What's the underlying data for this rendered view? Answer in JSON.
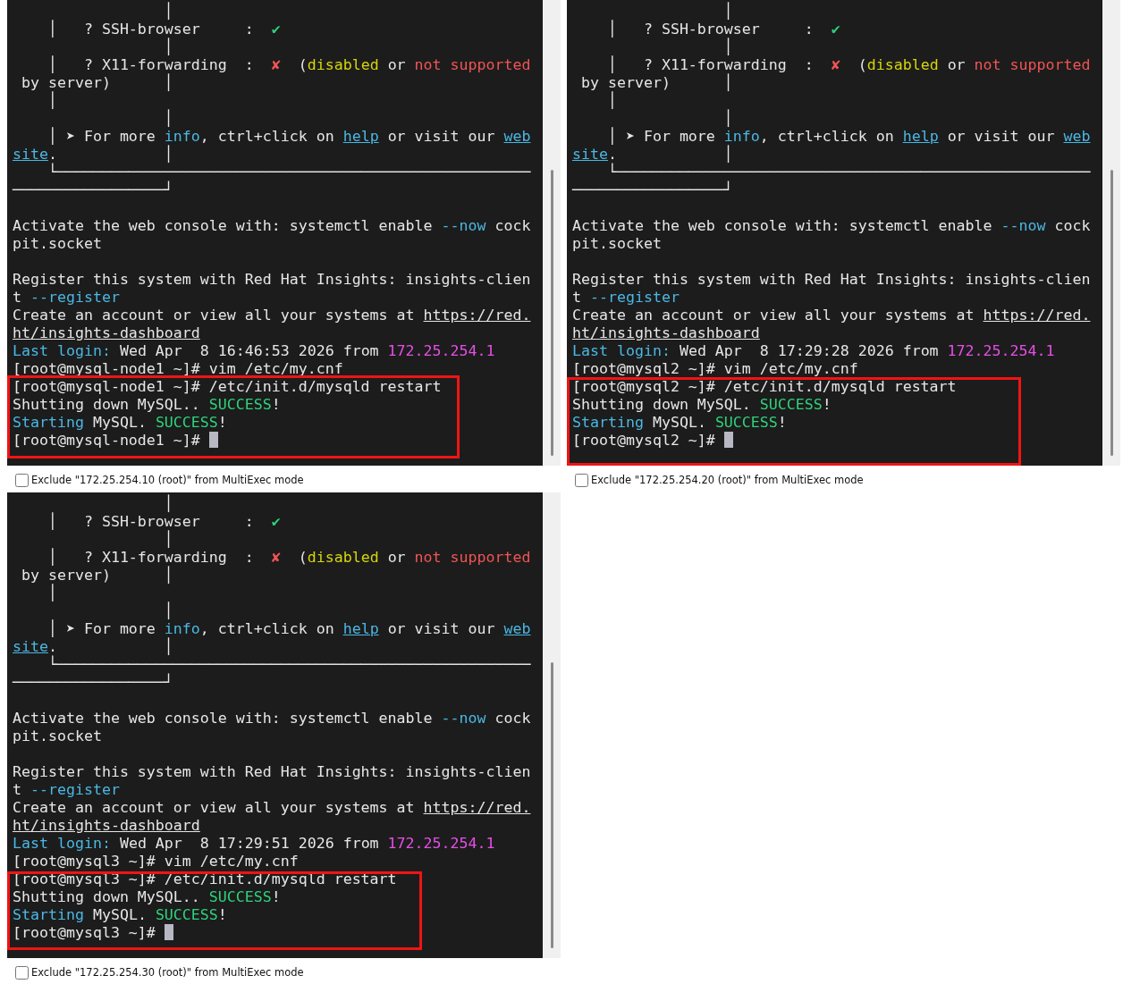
{
  "panes": [
    {
      "annotation_box": true,
      "lines": [
        {
          "spans": [
            {
              "text": "                 │"
            }
          ]
        },
        {
          "spans": [
            {
              "text": "    │   ? SSH-browser     :  "
            },
            {
              "text": "✔",
              "kind": "green"
            }
          ]
        },
        {
          "spans": [
            {
              "text": "                 │"
            }
          ]
        },
        {
          "spans": [
            {
              "text": "    │   ? X11-forwarding  :  "
            },
            {
              "text": "✘",
              "kind": "red"
            },
            {
              "text": "  ("
            },
            {
              "text": "disabled",
              "kind": "yellow"
            },
            {
              "text": " or "
            },
            {
              "text": "not supported",
              "kind": "red"
            }
          ]
        },
        {
          "spans": [
            {
              "text": " by server)      │"
            }
          ]
        },
        {
          "spans": [
            {
              "text": "    │"
            }
          ]
        },
        {
          "spans": [
            {
              "text": "                 │"
            }
          ]
        },
        {
          "spans": [
            {
              "text": "    │ ➤ For more "
            },
            {
              "text": "info",
              "kind": "cyan"
            },
            {
              "text": ", ctrl+click on "
            },
            {
              "text": "help",
              "kind": "link"
            },
            {
              "text": " or visit our "
            },
            {
              "text": "web",
              "kind": "link"
            }
          ]
        },
        {
          "spans": [
            {
              "text": "site",
              "kind": "link"
            },
            {
              "text": ".            │"
            }
          ]
        },
        {
          "spans": [
            {
              "text": "    └─────────────────────────────────────────────────────"
            }
          ]
        },
        {
          "spans": [
            {
              "text": "─────────────────┘"
            }
          ]
        },
        {
          "kind": "blank"
        },
        {
          "spans": [
            {
              "text": "Activate the web console with: systemctl enable "
            },
            {
              "text": "--now",
              "kind": "cyan"
            },
            {
              "text": " cock"
            }
          ]
        },
        {
          "spans": [
            {
              "text": "pit.socket"
            }
          ]
        },
        {
          "kind": "blank"
        },
        {
          "spans": [
            {
              "text": "Register this system with Red Hat Insights: insights-clien"
            }
          ]
        },
        {
          "spans": [
            {
              "text": "t "
            },
            {
              "text": "--register",
              "kind": "cyan"
            }
          ]
        },
        {
          "spans": [
            {
              "text": "Create an account or view all your systems at "
            },
            {
              "text": "https://red.",
              "kind": "url"
            }
          ]
        },
        {
          "spans": [
            {
              "text": "ht/insights-dashboard",
              "kind": "url"
            }
          ]
        },
        {
          "spans": [
            {
              "text": "Last login:",
              "kind": "cyan"
            },
            {
              "text": " Wed Apr  8 16:46:53 2026 from "
            },
            {
              "text": "172.25.254.1",
              "kind": "magenta"
            }
          ]
        },
        {
          "spans": [
            {
              "text": "[root@mysql-node1 ~]# vim /etc/my.cnf"
            }
          ]
        },
        {
          "spans": [
            {
              "text": "[root@mysql-node1 ~]# /etc/init.d/mysqld restart"
            }
          ]
        },
        {
          "spans": [
            {
              "text": "Shutting down MySQL.. "
            },
            {
              "text": "SUCCESS",
              "kind": "green"
            },
            {
              "text": "!"
            }
          ]
        },
        {
          "spans": [
            {
              "text": "Starting",
              "kind": "cyan"
            },
            {
              "text": " MySQL. "
            },
            {
              "text": "SUCCESS",
              "kind": "green"
            },
            {
              "text": "!"
            }
          ]
        },
        {
          "kind": "prompt",
          "spans": [
            {
              "text": "[root@mysql-node1 ~]# "
            }
          ]
        }
      ],
      "exclude": {
        "label": "Exclude \"172.25.254.10 (root)\" from MultiExec mode",
        "checked": false
      }
    },
    {
      "annotation_box": true,
      "lines": [
        {
          "spans": [
            {
              "text": "                 │"
            }
          ]
        },
        {
          "spans": [
            {
              "text": "    │   ? SSH-browser     :  "
            },
            {
              "text": "✔",
              "kind": "green"
            }
          ]
        },
        {
          "spans": [
            {
              "text": "                 │"
            }
          ]
        },
        {
          "spans": [
            {
              "text": "    │   ? X11-forwarding  :  "
            },
            {
              "text": "✘",
              "kind": "red"
            },
            {
              "text": "  ("
            },
            {
              "text": "disabled",
              "kind": "yellow"
            },
            {
              "text": " or "
            },
            {
              "text": "not supported",
              "kind": "red"
            }
          ]
        },
        {
          "spans": [
            {
              "text": " by server)      │"
            }
          ]
        },
        {
          "spans": [
            {
              "text": "    │"
            }
          ]
        },
        {
          "spans": [
            {
              "text": "                 │"
            }
          ]
        },
        {
          "spans": [
            {
              "text": "    │ ➤ For more "
            },
            {
              "text": "info",
              "kind": "cyan"
            },
            {
              "text": ", ctrl+click on "
            },
            {
              "text": "help",
              "kind": "link"
            },
            {
              "text": " or visit our "
            },
            {
              "text": "web",
              "kind": "link"
            }
          ]
        },
        {
          "spans": [
            {
              "text": "site",
              "kind": "link"
            },
            {
              "text": ".            │"
            }
          ]
        },
        {
          "spans": [
            {
              "text": "    └─────────────────────────────────────────────────────"
            }
          ]
        },
        {
          "spans": [
            {
              "text": "─────────────────┘"
            }
          ]
        },
        {
          "kind": "blank"
        },
        {
          "spans": [
            {
              "text": "Activate the web console with: systemctl enable "
            },
            {
              "text": "--now",
              "kind": "cyan"
            },
            {
              "text": " cock"
            }
          ]
        },
        {
          "spans": [
            {
              "text": "pit.socket"
            }
          ]
        },
        {
          "kind": "blank"
        },
        {
          "spans": [
            {
              "text": "Register this system with Red Hat Insights: insights-clien"
            }
          ]
        },
        {
          "spans": [
            {
              "text": "t "
            },
            {
              "text": "--register",
              "kind": "cyan"
            }
          ]
        },
        {
          "spans": [
            {
              "text": "Create an account or view all your systems at "
            },
            {
              "text": "https://red.",
              "kind": "url"
            }
          ]
        },
        {
          "spans": [
            {
              "text": "ht/insights-dashboard",
              "kind": "url"
            }
          ]
        },
        {
          "spans": [
            {
              "text": "Last login:",
              "kind": "cyan"
            },
            {
              "text": " Wed Apr  8 17:29:28 2026 from "
            },
            {
              "text": "172.25.254.1",
              "kind": "magenta"
            }
          ]
        },
        {
          "spans": [
            {
              "text": "[root@mysql2 ~]# vim /etc/my.cnf"
            }
          ]
        },
        {
          "spans": [
            {
              "text": "[root@mysql2 ~]# /etc/init.d/mysqld restart"
            }
          ]
        },
        {
          "spans": [
            {
              "text": "Shutting down MySQL. "
            },
            {
              "text": "SUCCESS",
              "kind": "green"
            },
            {
              "text": "!"
            }
          ]
        },
        {
          "spans": [
            {
              "text": "Starting",
              "kind": "cyan"
            },
            {
              "text": " MySQL. "
            },
            {
              "text": "SUCCESS",
              "kind": "green"
            },
            {
              "text": "!"
            }
          ]
        },
        {
          "kind": "prompt",
          "spans": [
            {
              "text": "[root@mysql2 ~]# "
            }
          ]
        }
      ],
      "exclude": {
        "label": "Exclude \"172.25.254.20 (root)\" from MultiExec mode",
        "checked": false
      }
    },
    {
      "annotation_box": true,
      "lines": [
        {
          "spans": [
            {
              "text": "                 │"
            }
          ]
        },
        {
          "spans": [
            {
              "text": "    │   ? SSH-browser     :  "
            },
            {
              "text": "✔",
              "kind": "green"
            }
          ]
        },
        {
          "spans": [
            {
              "text": "                 │"
            }
          ]
        },
        {
          "spans": [
            {
              "text": "    │   ? X11-forwarding  :  "
            },
            {
              "text": "✘",
              "kind": "red"
            },
            {
              "text": "  ("
            },
            {
              "text": "disabled",
              "kind": "yellow"
            },
            {
              "text": " or "
            },
            {
              "text": "not supported",
              "kind": "red"
            }
          ]
        },
        {
          "spans": [
            {
              "text": " by server)      │"
            }
          ]
        },
        {
          "spans": [
            {
              "text": "    │"
            }
          ]
        },
        {
          "spans": [
            {
              "text": "                 │"
            }
          ]
        },
        {
          "spans": [
            {
              "text": "    │ ➤ For more "
            },
            {
              "text": "info",
              "kind": "cyan"
            },
            {
              "text": ", ctrl+click on "
            },
            {
              "text": "help",
              "kind": "link"
            },
            {
              "text": " or visit our "
            },
            {
              "text": "web",
              "kind": "link"
            }
          ]
        },
        {
          "spans": [
            {
              "text": "site",
              "kind": "link"
            },
            {
              "text": ".            │"
            }
          ]
        },
        {
          "spans": [
            {
              "text": "    └─────────────────────────────────────────────────────"
            }
          ]
        },
        {
          "spans": [
            {
              "text": "─────────────────┘"
            }
          ]
        },
        {
          "kind": "blank"
        },
        {
          "spans": [
            {
              "text": "Activate the web console with: systemctl enable "
            },
            {
              "text": "--now",
              "kind": "cyan"
            },
            {
              "text": " cock"
            }
          ]
        },
        {
          "spans": [
            {
              "text": "pit.socket"
            }
          ]
        },
        {
          "kind": "blank"
        },
        {
          "spans": [
            {
              "text": "Register this system with Red Hat Insights: insights-clien"
            }
          ]
        },
        {
          "spans": [
            {
              "text": "t "
            },
            {
              "text": "--register",
              "kind": "cyan"
            }
          ]
        },
        {
          "spans": [
            {
              "text": "Create an account or view all your systems at "
            },
            {
              "text": "https://red.",
              "kind": "url"
            }
          ]
        },
        {
          "spans": [
            {
              "text": "ht/insights-dashboard",
              "kind": "url"
            }
          ]
        },
        {
          "spans": [
            {
              "text": "Last login:",
              "kind": "cyan"
            },
            {
              "text": " Wed Apr  8 17:29:51 2026 from "
            },
            {
              "text": "172.25.254.1",
              "kind": "magenta"
            }
          ]
        },
        {
          "spans": [
            {
              "text": "[root@mysql3 ~]# vim /etc/my.cnf"
            }
          ]
        },
        {
          "spans": [
            {
              "text": "[root@mysql3 ~]# /etc/init.d/mysqld restart"
            }
          ]
        },
        {
          "spans": [
            {
              "text": "Shutting down MySQL.. "
            },
            {
              "text": "SUCCESS",
              "kind": "green"
            },
            {
              "text": "!"
            }
          ]
        },
        {
          "spans": [
            {
              "text": "Starting",
              "kind": "cyan"
            },
            {
              "text": " MySQL. "
            },
            {
              "text": "SUCCESS",
              "kind": "green"
            },
            {
              "text": "!"
            }
          ]
        },
        {
          "kind": "prompt",
          "spans": [
            {
              "text": "[root@mysql3 ~]# "
            }
          ]
        }
      ],
      "exclude": {
        "label": "Exclude \"172.25.254.30 (root)\" from MultiExec mode",
        "checked": false
      }
    }
  ]
}
